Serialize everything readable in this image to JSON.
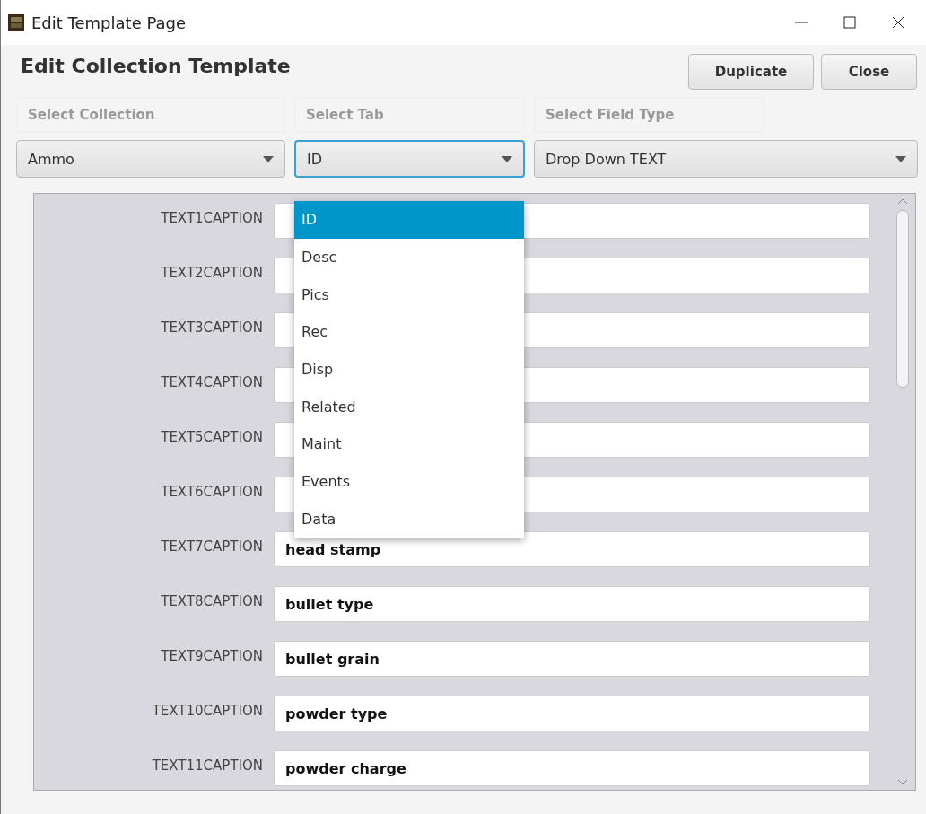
{
  "window": {
    "title": "Edit Template Page"
  },
  "heading": "Edit Collection Template",
  "buttons": [
    "Duplicate",
    "Close"
  ],
  "selectors": [
    {
      "label": "Select Collection",
      "value": "Ammo",
      "focused": false
    },
    {
      "label": "Select Tab",
      "value": "ID",
      "focused": true
    },
    {
      "label": "Select Field Type",
      "value": "Drop Down TEXT",
      "focused": false
    }
  ],
  "tab_dropdown": {
    "options": [
      {
        "label": "ID",
        "selected": true
      },
      {
        "label": "Desc",
        "selected": false
      },
      {
        "label": "Pics",
        "selected": false
      },
      {
        "label": "Rec",
        "selected": false
      },
      {
        "label": "Disp",
        "selected": false
      },
      {
        "label": "Related",
        "selected": false
      },
      {
        "label": "Maint",
        "selected": false
      },
      {
        "label": "Events",
        "selected": false
      },
      {
        "label": "Data",
        "selected": false
      }
    ]
  },
  "rows": [
    {
      "caption": "TEXT1CAPTION"
    },
    {
      "caption": "TEXT2CAPTION"
    },
    {
      "caption": "TEXT3CAPTION"
    },
    {
      "caption": "TEXT4CAPTION"
    },
    {
      "caption": "TEXT5CAPTION"
    },
    {
      "caption": "TEXT6CAPTION"
    },
    {
      "caption": "TEXT7CAPTION",
      "value": "head stamp"
    },
    {
      "caption": "TEXT8CAPTION",
      "value": "bullet type"
    },
    {
      "caption": "TEXT9CAPTION",
      "value": "bullet grain"
    },
    {
      "caption": "TEXT10CAPTION",
      "value": "powder type"
    },
    {
      "caption": "TEXT11CAPTION",
      "value": "powder charge"
    }
  ]
}
